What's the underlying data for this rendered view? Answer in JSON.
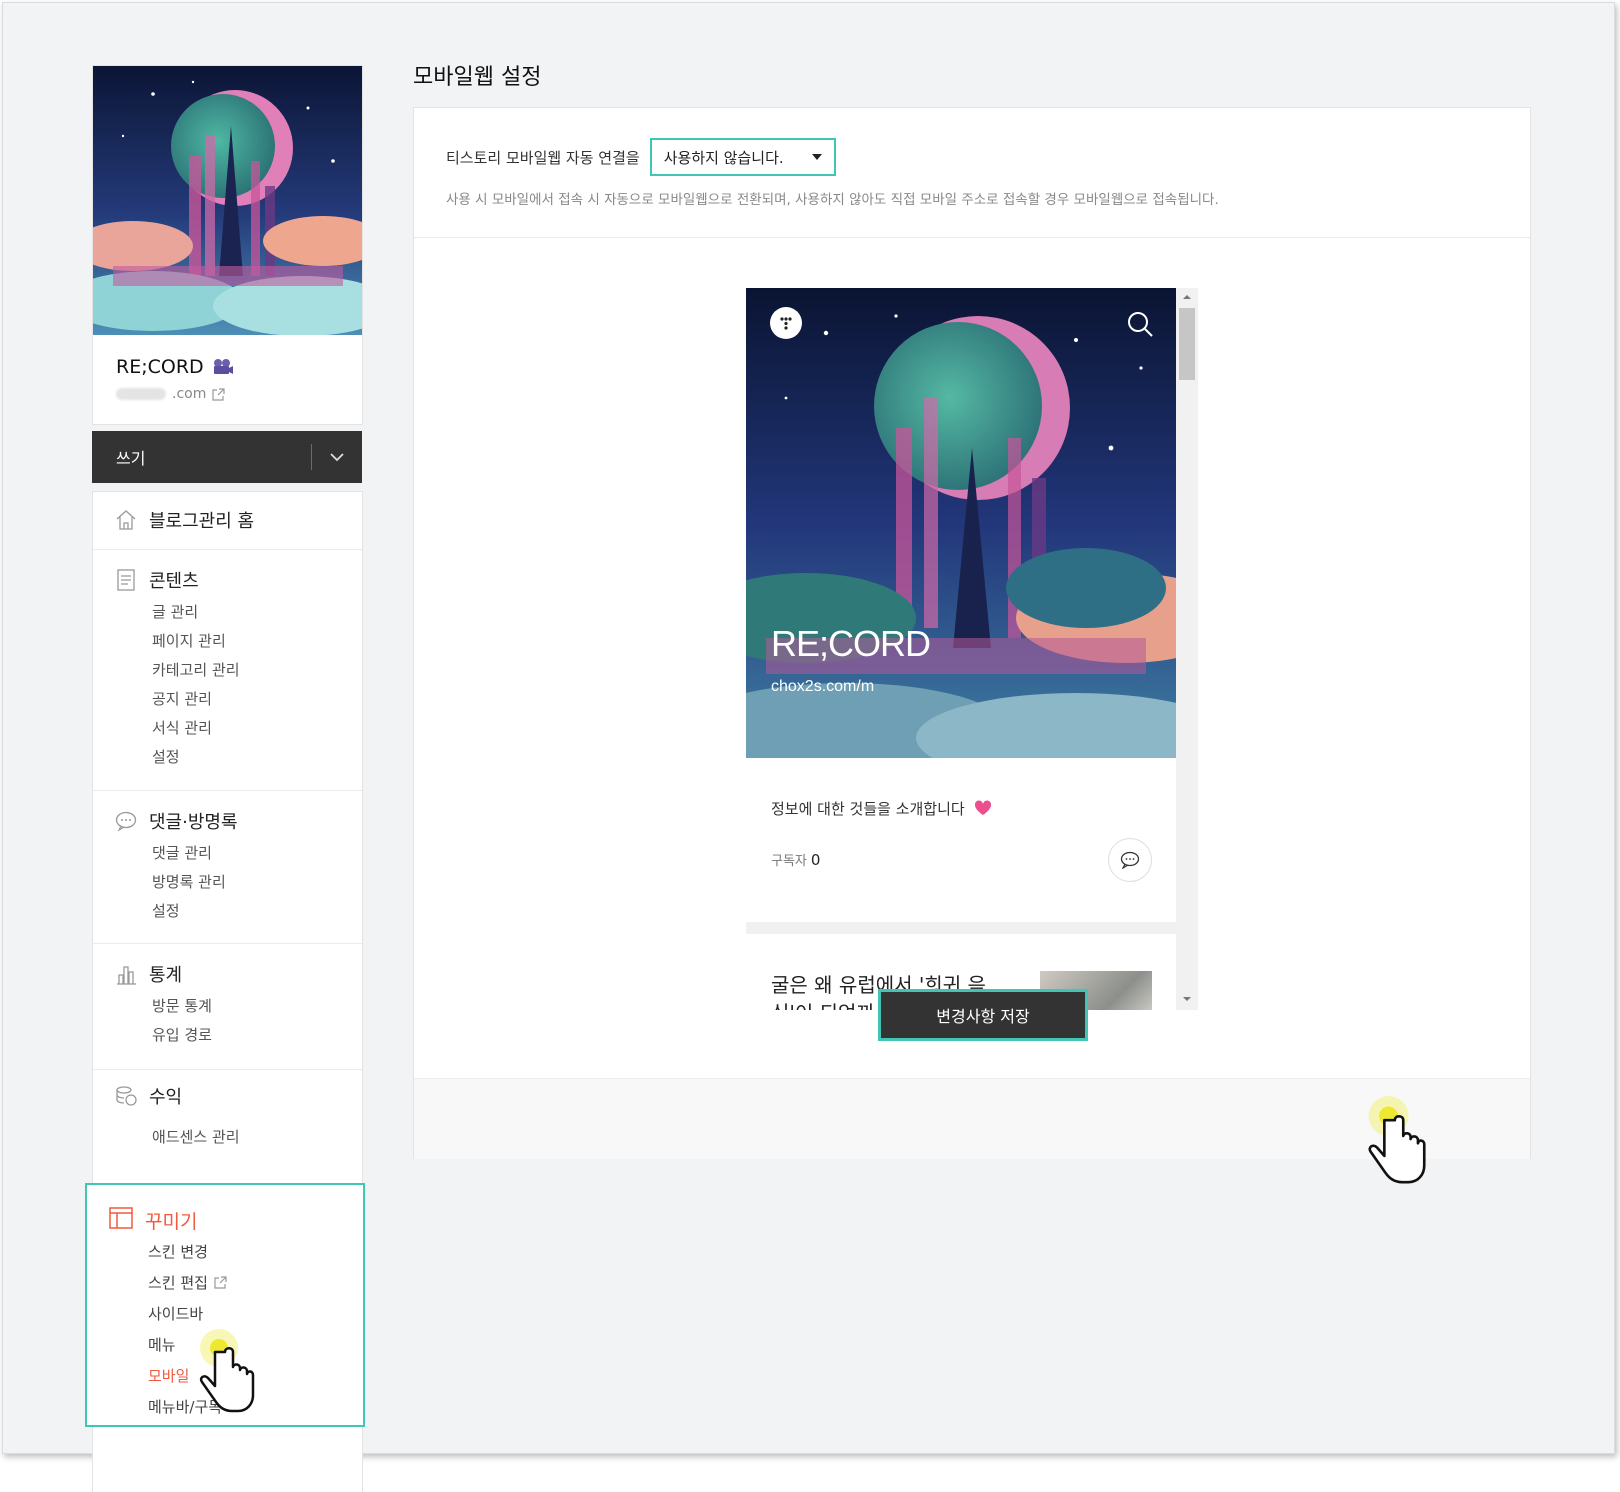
{
  "page_title": "모바일웹 설정",
  "profile": {
    "blog_name": "RE;CORD",
    "blog_url_suffix": ".com"
  },
  "write": {
    "label": "쓰기"
  },
  "menu": {
    "home": "블로그관리 홈",
    "contents": {
      "title": "콘텐츠",
      "items": [
        "글 관리",
        "페이지 관리",
        "카테고리 관리",
        "공지 관리",
        "서식 관리",
        "설정"
      ]
    },
    "comments": {
      "title": "댓글·방명록",
      "items": [
        "댓글 관리",
        "방명록 관리",
        "설정"
      ]
    },
    "stats": {
      "title": "통계",
      "items": [
        "방문 통계",
        "유입 경로"
      ]
    },
    "revenue": {
      "title": "수익",
      "items": [
        "애드센스 관리"
      ]
    },
    "decorate": {
      "title": "꾸미기",
      "items": [
        "스킨 변경",
        "스킨 편집",
        "사이드바",
        "메뉴",
        "모바일",
        "메뉴바/구독"
      ]
    }
  },
  "setting": {
    "label": "티스토리 모바일웹 자동 연결을",
    "select_value": "사용하지 않습니다.",
    "help": "사용 시 모바일에서 접속 시 자동으로 모바일웹으로 전환되며, 사용하지 않아도 직접 모바일 주소로 접속할 경우 모바일웹으로 접속됩니다."
  },
  "preview": {
    "blog_name": "RE;CORD",
    "url": "chox2s.com/m",
    "description": "정보에 대한 것들을 소개합니다",
    "subscribers_label": "구독자",
    "subscribers_count": "0",
    "post_title": "굴은 왜 유럽에서 '희귀 음식'이 되었까"
  },
  "save_button": "변경사항 저장",
  "colors": {
    "accent_teal": "#3ec7b4",
    "active_red": "#f05a3f",
    "dark_button": "#333333"
  }
}
